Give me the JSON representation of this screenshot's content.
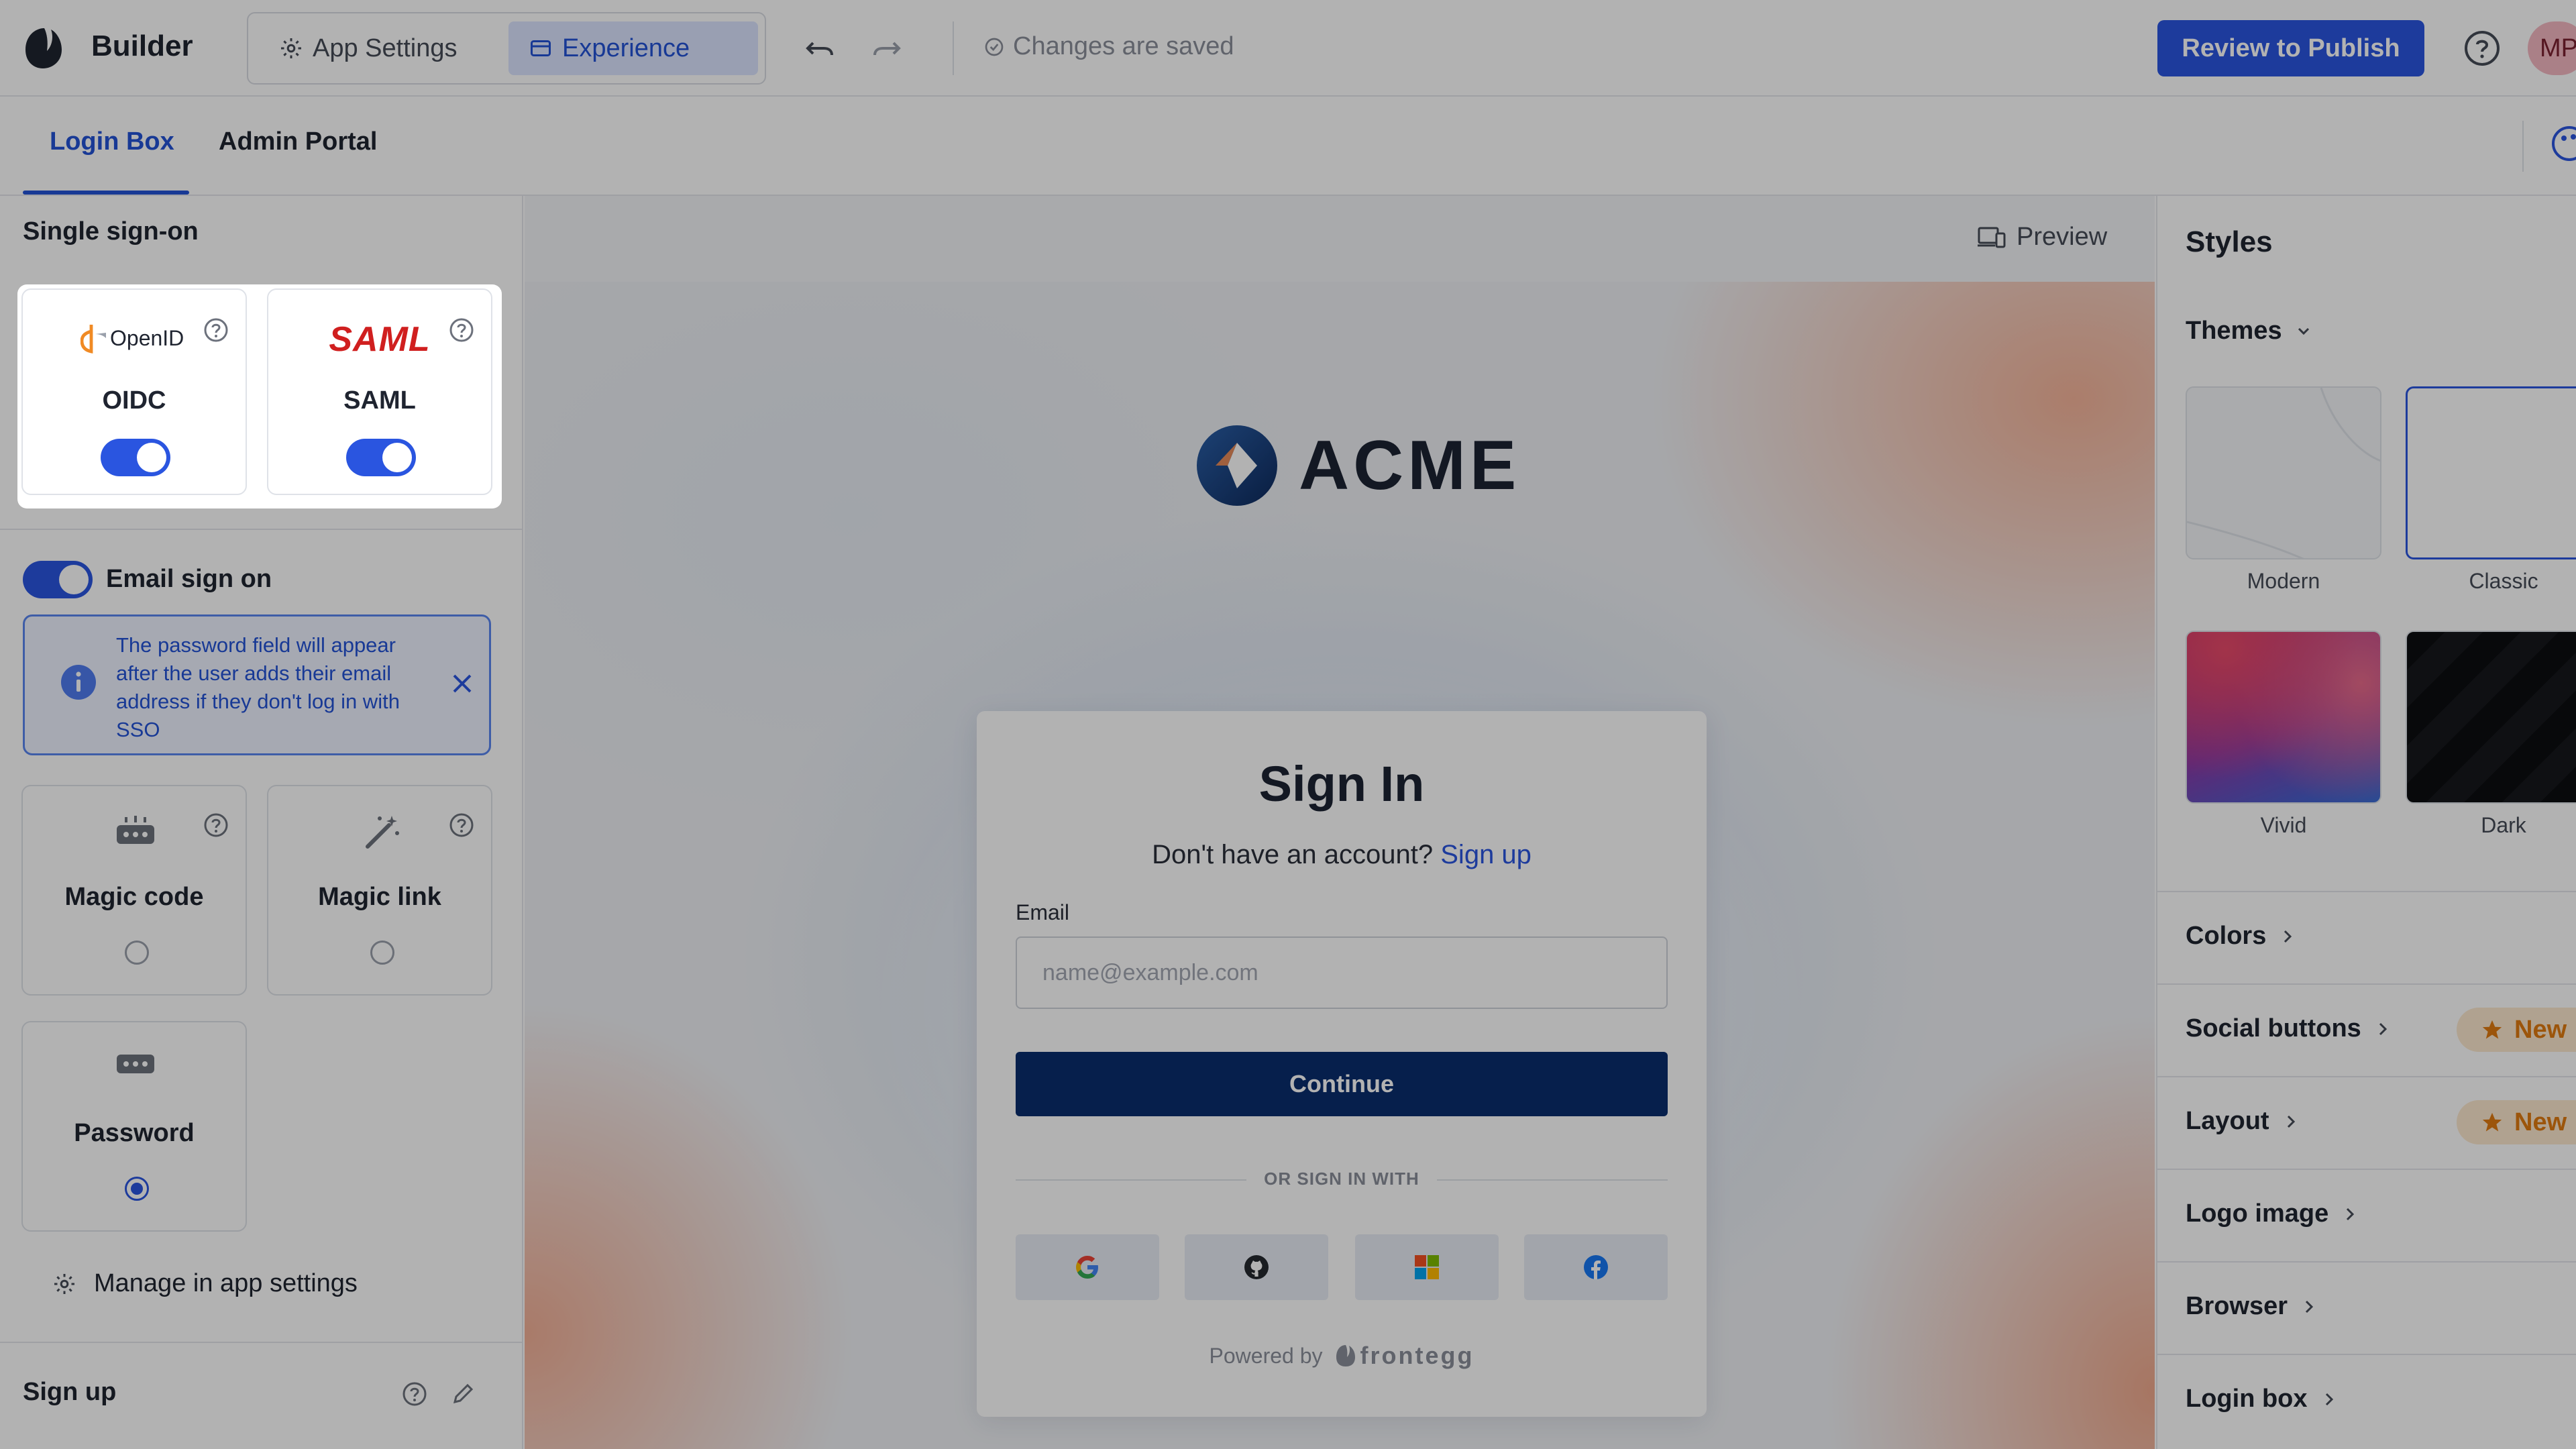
{
  "header": {
    "brand": "Builder",
    "tabs": [
      {
        "label": "App Settings"
      },
      {
        "label": "Experience"
      }
    ],
    "status": "Changes are saved",
    "publish_label": "Review to Publish",
    "avatar_initials": "MP"
  },
  "subtabs": [
    {
      "label": "Login Box"
    },
    {
      "label": "Admin Portal"
    }
  ],
  "left_panel": {
    "sso_title": "Single sign-on",
    "sso_providers": [
      {
        "logo_text": "OpenID",
        "title": "OIDC",
        "enabled": true
      },
      {
        "logo_text": "SAML",
        "title": "SAML",
        "enabled": true
      }
    ],
    "email_sign_on": {
      "label": "Email sign on",
      "enabled": true
    },
    "info_text": "The password field will appear after the user adds their email address if they don't log in with SSO",
    "methods": [
      {
        "title": "Magic code",
        "selected": false
      },
      {
        "title": "Magic link",
        "selected": false
      },
      {
        "title": "Password",
        "selected": true
      }
    ],
    "manage_label": "Manage in app settings",
    "signup_title": "Sign up"
  },
  "canvas": {
    "preview_label": "Preview",
    "brand_logo_text": "ACME",
    "signin": {
      "title": "Sign In",
      "subtitle_prefix": "Don't have an account?",
      "signup_link": "Sign up",
      "email_label": "Email",
      "email_placeholder": "name@example.com",
      "continue_label": "Continue",
      "or_text": "OR SIGN IN WITH",
      "social_icons": [
        "google-icon",
        "github-icon",
        "microsoft-icon",
        "facebook-icon"
      ],
      "powered_by": "Powered by",
      "powered_brand": "frontegg"
    }
  },
  "right_panel": {
    "title": "Styles",
    "themes_label": "Themes",
    "themes": [
      {
        "name": "Modern"
      },
      {
        "name": "Classic"
      },
      {
        "name": "Vivid"
      },
      {
        "name": "Dark"
      }
    ],
    "sections": [
      {
        "label": "Colors",
        "badge": ""
      },
      {
        "label": "Social buttons",
        "badge": "New"
      },
      {
        "label": "Layout",
        "badge": "New"
      },
      {
        "label": "Logo image",
        "badge": ""
      },
      {
        "label": "Browser",
        "badge": ""
      },
      {
        "label": "Login box",
        "badge": ""
      }
    ]
  },
  "colors": {
    "accent": "#2a55e0",
    "continue_button": "#0a2d6e",
    "new_badge": "#e07a10"
  }
}
